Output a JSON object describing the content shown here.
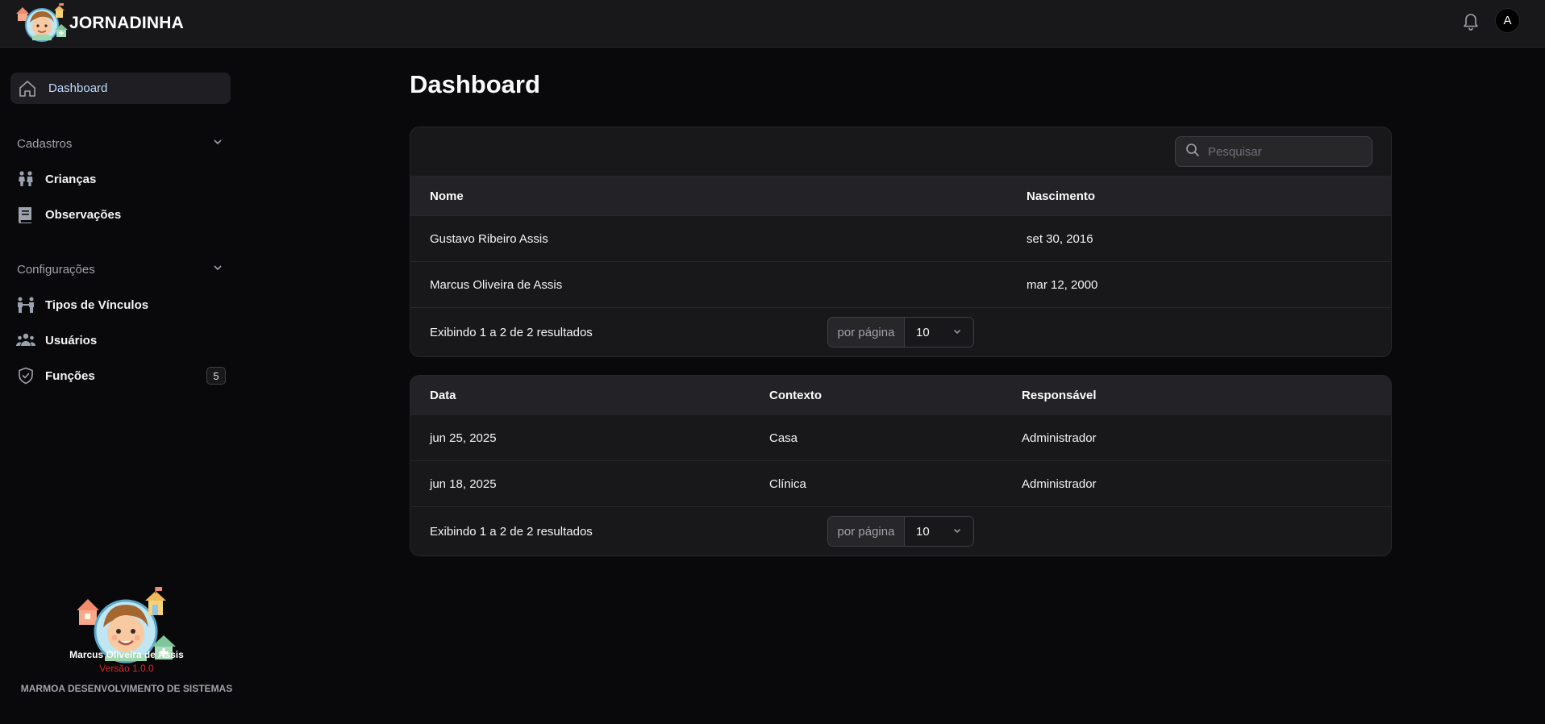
{
  "app": {
    "name": "JORNADINHA",
    "avatar_letter": "A"
  },
  "sidebar": {
    "active": {
      "label": "Dashboard",
      "icon": "home-icon"
    },
    "groups": [
      {
        "title": "Cadastros",
        "items": [
          {
            "label": "Crianças",
            "icon": "children-icon"
          },
          {
            "label": "Observações",
            "icon": "book-icon"
          }
        ]
      },
      {
        "title": "Configurações",
        "items": [
          {
            "label": "Tipos de Vínculos",
            "icon": "link-people-icon"
          },
          {
            "label": "Usuários",
            "icon": "users-icon"
          },
          {
            "label": "Funções",
            "icon": "shield-icon",
            "badge": "5"
          }
        ]
      }
    ],
    "footer": {
      "company": "MARMOA DESENVOLVIMENTO DE SISTEMAS",
      "user": "Marcus Oliveira de Assis",
      "version": "Versão 1.0.0"
    }
  },
  "main": {
    "title": "Dashboard",
    "children_table": {
      "search_placeholder": "Pesquisar",
      "columns": [
        "Nome",
        "Nascimento"
      ],
      "rows": [
        [
          "Gustavo Ribeiro Assis",
          "set 30, 2016"
        ],
        [
          "Marcus Oliveira de Assis",
          "mar 12, 2000"
        ]
      ],
      "footer_info": "Exibindo 1 a 2 de 2 resultados",
      "per_page_label": "por página",
      "per_page_value": "10"
    },
    "observations_table": {
      "columns": [
        "Data",
        "Contexto",
        "Responsável"
      ],
      "rows": [
        [
          "jun 25, 2025",
          "Casa",
          "Administrador"
        ],
        [
          "jun 18, 2025",
          "Clínica",
          "Administrador"
        ]
      ],
      "footer_info": "Exibindo 1 a 2 de 2 resultados",
      "per_page_label": "por página",
      "per_page_value": "10"
    }
  },
  "colors": {
    "background": "#09090b",
    "card": "#18181b",
    "active_link": "#bfdbfe",
    "version": "#dc2626"
  }
}
